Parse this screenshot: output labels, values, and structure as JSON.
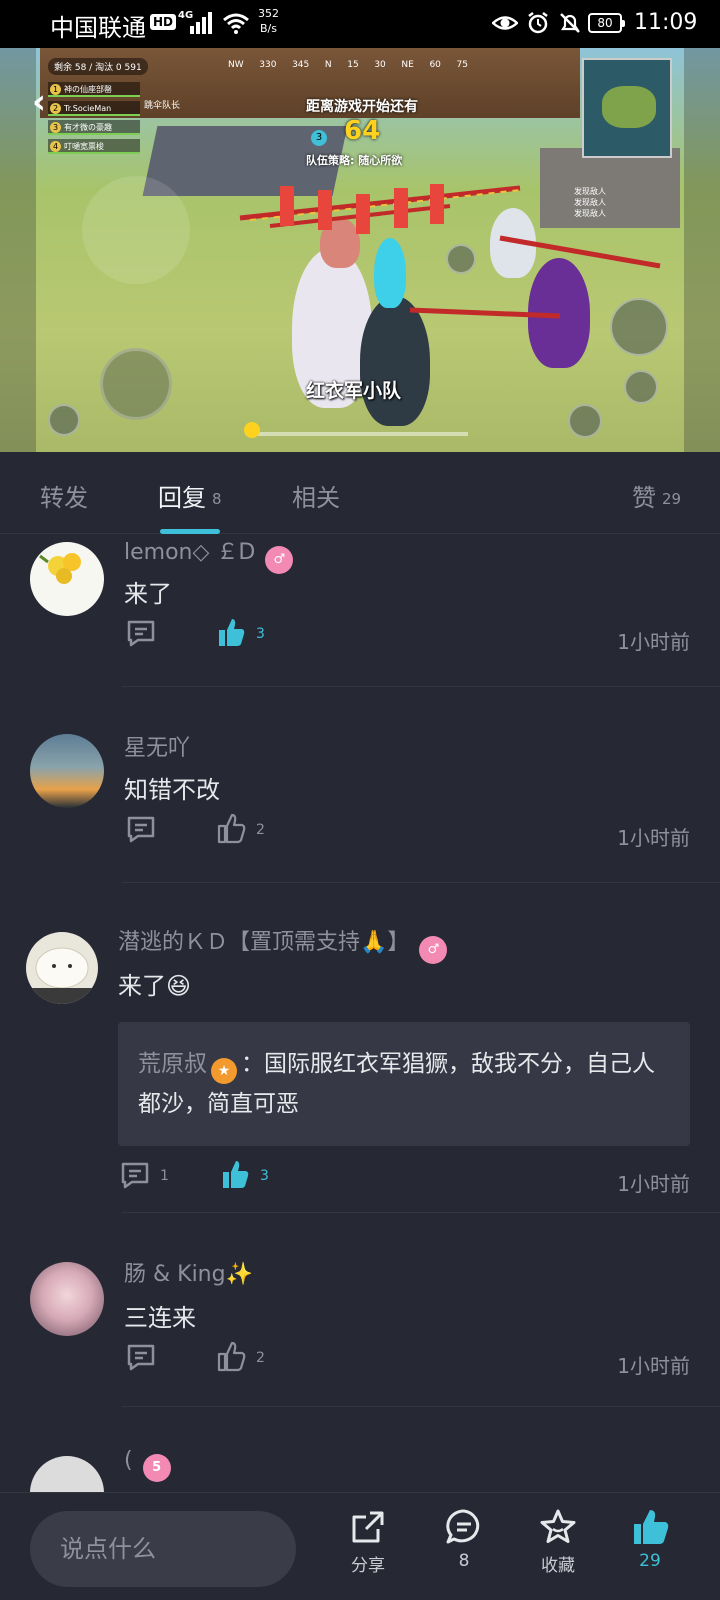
{
  "status_bar": {
    "carrier": "中国联通",
    "hd": "HD",
    "network": "4G",
    "speed_value": "352",
    "speed_unit": "B/s",
    "battery": "80",
    "time": "11:09"
  },
  "video": {
    "hud_stats": "剩余 58 / 淘汰 0   591",
    "team": [
      {
        "n": "1",
        "name": "神の仙座部罄"
      },
      {
        "n": "2",
        "name": "Tr.SocieMan"
      },
      {
        "n": "3",
        "name": "有才微の豪趣"
      },
      {
        "n": "4",
        "name": "叮嗵宽票梭"
      }
    ],
    "leader": "跳伞队长",
    "compass": [
      "NW",
      "330",
      "345",
      "N",
      "15",
      "30",
      "NE",
      "60",
      "75"
    ],
    "countdown_label": "距离游戏开始还有",
    "countdown": "64",
    "round_badge": "3",
    "strategy": "队伍策略: 随心所欲",
    "feed": [
      "发现敌人",
      "发现敌人",
      "发现敌人"
    ],
    "subtitle": "红衣军小队",
    "progress_badge": "1"
  },
  "tabs": [
    {
      "label": "转发",
      "count": ""
    },
    {
      "label": "回复",
      "count": "8"
    },
    {
      "label": "相关",
      "count": ""
    }
  ],
  "likes_tab": {
    "label": "赞",
    "count": "29"
  },
  "comments": [
    {
      "user": "lemon◇ ￡D",
      "badge": "♂",
      "text": "来了",
      "reply_count": "",
      "like_count": "3",
      "liked": true,
      "time": "1小时前"
    },
    {
      "user": "星无吖",
      "badge": "",
      "text": "知错不改",
      "reply_count": "",
      "like_count": "2",
      "liked": false,
      "time": "1小时前"
    },
    {
      "user": "潜逃的ＫＤ【置顶需支持🙏】",
      "badge": "♂",
      "text": "来了😆",
      "reply_count": "1",
      "like_count": "3",
      "liked": true,
      "time": "1小时前",
      "quote": {
        "user": "荒原叔",
        "text": "：国际服红衣军猖獗，敌我不分，自己人都沙，简直可恶"
      }
    },
    {
      "user": "肠 & King✨",
      "badge": "",
      "text": "三连来",
      "reply_count": "",
      "like_count": "2",
      "liked": false,
      "time": "1小时前"
    },
    {
      "user": "(",
      "badge": "5",
      "text": "",
      "reply_count": "",
      "like_count": "",
      "liked": false,
      "time": ""
    }
  ],
  "bottom_bar": {
    "input_placeholder": "说点什么",
    "share_label": "分享",
    "comment_count": "8",
    "favorite_label": "收藏",
    "like_count": "29"
  },
  "colors": {
    "accent": "#3ec0d8",
    "background": "#262834",
    "badge_pink": "#f28ab3"
  }
}
